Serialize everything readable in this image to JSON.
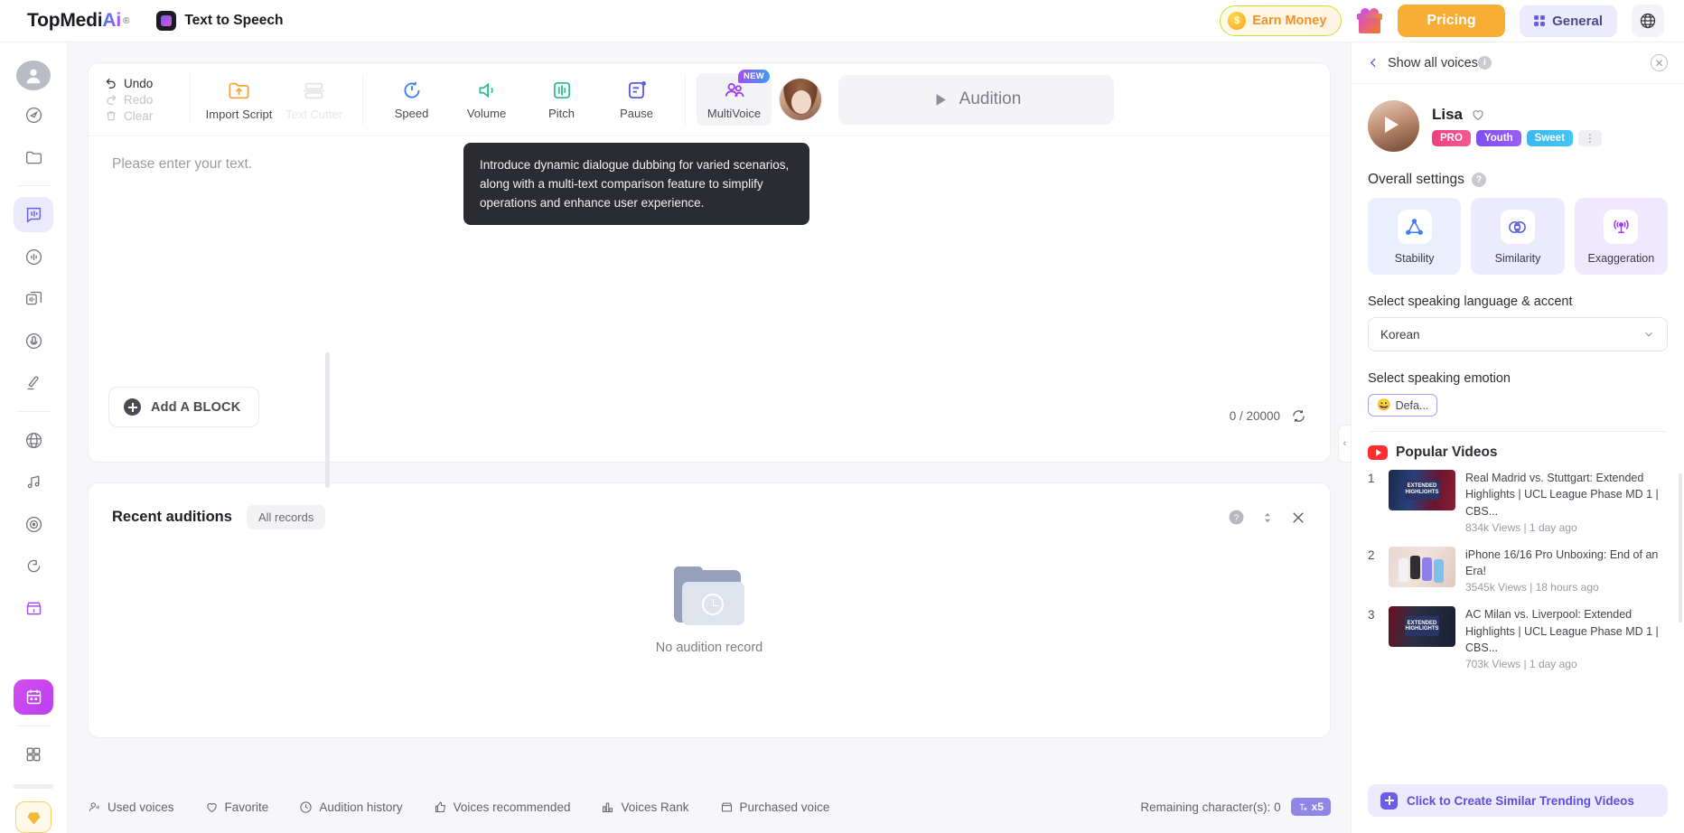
{
  "header": {
    "brand_main": "TopMedi",
    "brand_ai": "Ai",
    "brand_registered": "®",
    "app_name": "Text to Speech",
    "earn_money": "Earn Money",
    "coin_symbol": "$",
    "pricing": "Pricing",
    "general": "General"
  },
  "rail": {
    "items": [
      {
        "name": "profile-avatar"
      },
      {
        "name": "compass"
      },
      {
        "name": "folder"
      },
      {
        "name": "text-to-speech"
      },
      {
        "name": "voice-changer"
      },
      {
        "name": "batch-convert"
      },
      {
        "name": "voice-record"
      },
      {
        "name": "voice-clone"
      },
      {
        "name": "translate"
      },
      {
        "name": "music"
      },
      {
        "name": "disc"
      },
      {
        "name": "spiral"
      },
      {
        "name": "store"
      },
      {
        "name": "calendar"
      },
      {
        "name": "apps-grid"
      },
      {
        "name": "diamond-rewards"
      }
    ]
  },
  "toolbar": {
    "undo": "Undo",
    "redo": "Redo",
    "clear": "Clear",
    "import_script": "Import Script",
    "text_cutter": "Text Cutter",
    "speed": "Speed",
    "volume": "Volume",
    "pitch": "Pitch",
    "pause": "Pause",
    "multivoice": "MultiVoice",
    "multivoice_badge": "NEW",
    "audition": "Audition"
  },
  "tooltip": {
    "text": "Introduce dynamic dialogue dubbing for varied scenarios, along with a multi-text comparison feature to simplify operations and enhance user experience."
  },
  "editor": {
    "placeholder": "Please enter your text.",
    "add_block": "Add A BLOCK",
    "counter": "0 / 20000"
  },
  "auditions": {
    "title": "Recent auditions",
    "all_records": "All records",
    "empty_text": "No audition record"
  },
  "bottom_bar": {
    "items": [
      {
        "label": "Used voices",
        "icon": "used-voices-icon"
      },
      {
        "label": "Favorite",
        "icon": "heart-icon"
      },
      {
        "label": "Audition history",
        "icon": "clock-icon"
      },
      {
        "label": "Voices recommended",
        "icon": "thumbs-up-icon"
      },
      {
        "label": "Voices Rank",
        "icon": "bar-chart-icon"
      },
      {
        "label": "Purchased voice",
        "icon": "store-icon"
      }
    ],
    "remaining": "Remaining character(s): 0",
    "multiplier": "x5"
  },
  "right_panel": {
    "back_label": "Show all voices",
    "voice_name": "Lisa",
    "tags": [
      "PRO",
      "Youth",
      "Sweet"
    ],
    "overall_settings": "Overall settings",
    "settings": [
      {
        "label": "Stability",
        "icon": "stability-icon"
      },
      {
        "label": "Similarity",
        "icon": "similarity-icon"
      },
      {
        "label": "Exaggeration",
        "icon": "exaggeration-icon"
      }
    ],
    "language_label": "Select speaking language & accent",
    "language_value": "Korean",
    "emotion_label": "Select speaking emotion",
    "emotion_value": "Defa...",
    "emotion_emoji": "😀",
    "popular_videos_title": "Popular Videos",
    "videos": [
      {
        "rank": "1",
        "title": "Real Madrid vs. Stuttgart: Extended Highlights | UCL League Phase MD 1 | CBS...",
        "meta": "834k Views | 1 day ago",
        "thumb_text": "EXTENDED HIGHLIGHTS"
      },
      {
        "rank": "2",
        "title": "iPhone 16/16 Pro Unboxing: End of an Era!",
        "meta": "3545k Views | 18 hours ago",
        "thumb_text": ""
      },
      {
        "rank": "3",
        "title": "AC Milan vs. Liverpool: Extended Highlights | UCL League Phase MD 1 | CBS...",
        "meta": "703k Views | 1 day ago",
        "thumb_text": "EXTENDED HIGHLIGHTS"
      }
    ],
    "cta": "Click to Create Similar Trending Videos"
  },
  "colors": {
    "accent_purple": "#6d5ce7",
    "pricing_orange": "#f8ad34",
    "earn_border": "#c6e13f"
  }
}
